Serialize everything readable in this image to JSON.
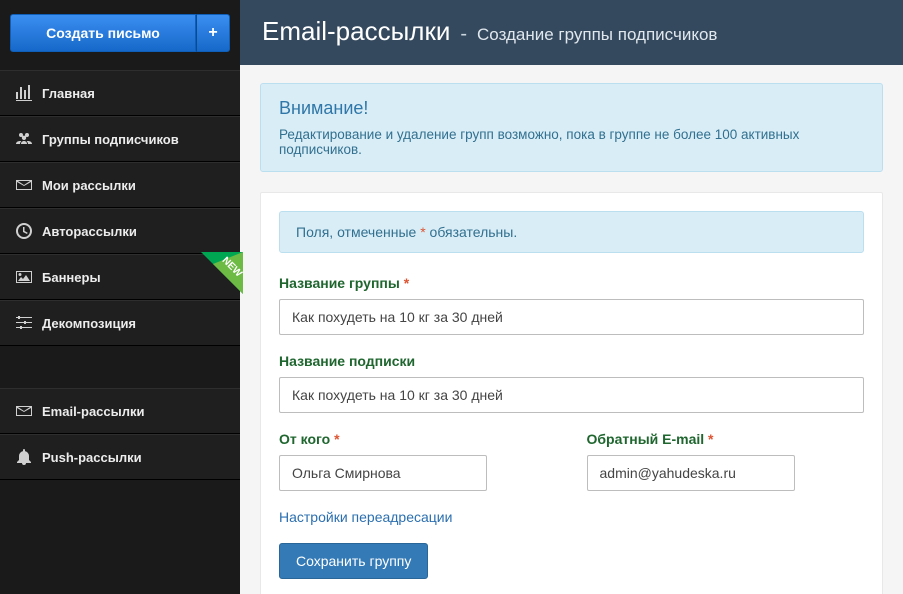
{
  "sidebar": {
    "create_label": "Создать письмо",
    "items": [
      {
        "label": "Главная"
      },
      {
        "label": "Группы подписчиков"
      },
      {
        "label": "Мои рассылки"
      },
      {
        "label": "Авторассылки"
      },
      {
        "label": "Баннеры"
      },
      {
        "label": "Декомпозиция"
      }
    ],
    "items2": [
      {
        "label": "Email-рассылки"
      },
      {
        "label": "Push-рассылки"
      }
    ]
  },
  "header": {
    "title": "Email-рассылки",
    "subtitle": "Создание группы подписчиков"
  },
  "alert": {
    "title": "Внимание!",
    "text": "Редактирование и удаление групп возможно, пока в группе не более 100 активных подписчиков."
  },
  "form": {
    "required_note_pre": "Поля, отмеченные ",
    "required_note_post": " обязательны.",
    "group_name_label": "Название группы",
    "group_name_value": "Как похудеть на 10 кг за 30 дней",
    "subscription_name_label": "Название подписки",
    "subscription_name_value": "Как похудеть на 10 кг за 30 дней",
    "from_label": "От кого",
    "from_value": "Ольга Смирнова",
    "reply_label": "Обратный E-mail",
    "reply_value": "admin@yahudeska.ru",
    "redirect_link": "Настройки переадресации",
    "save_label": "Сохранить группу"
  }
}
